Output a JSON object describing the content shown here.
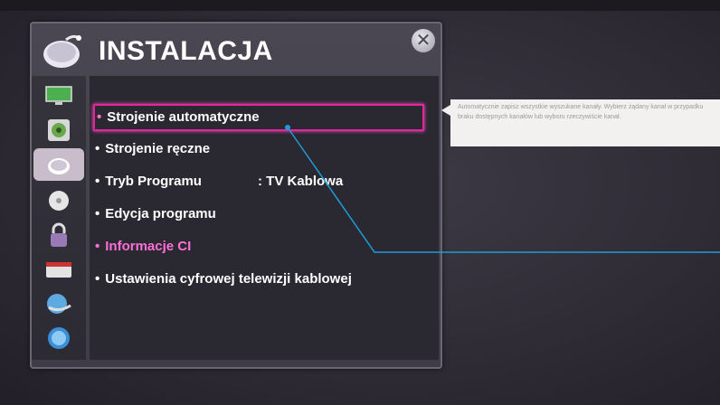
{
  "window": {
    "title": "INSTALACJA",
    "close_label": "✕"
  },
  "sidebar": {
    "items": [
      {
        "icon": "tv-screen-icon",
        "active": false
      },
      {
        "icon": "speaker-icon",
        "active": false
      },
      {
        "icon": "satellite-dish-icon",
        "active": true
      },
      {
        "icon": "clock-icon",
        "active": false
      },
      {
        "icon": "lock-icon",
        "active": false
      },
      {
        "icon": "keyboard-icon",
        "active": false
      },
      {
        "icon": "network-icon",
        "active": false
      },
      {
        "icon": "help-icon",
        "active": false
      }
    ]
  },
  "menu": {
    "items": [
      {
        "label": "Strojenie automatyczne",
        "selected": true
      },
      {
        "label": "Strojenie ręczne"
      },
      {
        "label": "Tryb Programu",
        "value": ": TV Kablowa"
      },
      {
        "label": "Edycja programu"
      },
      {
        "label": "Informacje CI",
        "highlight": true
      },
      {
        "label": "Ustawienia cyfrowej telewizji kablowej"
      }
    ]
  },
  "tooltip": {
    "text": "Automatycznie zapisz wszystkie wyszukane kanały. Wybierz żądany kanał w przypadku braku dostępnych kanałów lub wyboru rzeczywiście kanał."
  },
  "colors": {
    "accent": "#e0289c",
    "panel_bg": "#2a2830",
    "annotation_line": "#1e9bd8"
  }
}
